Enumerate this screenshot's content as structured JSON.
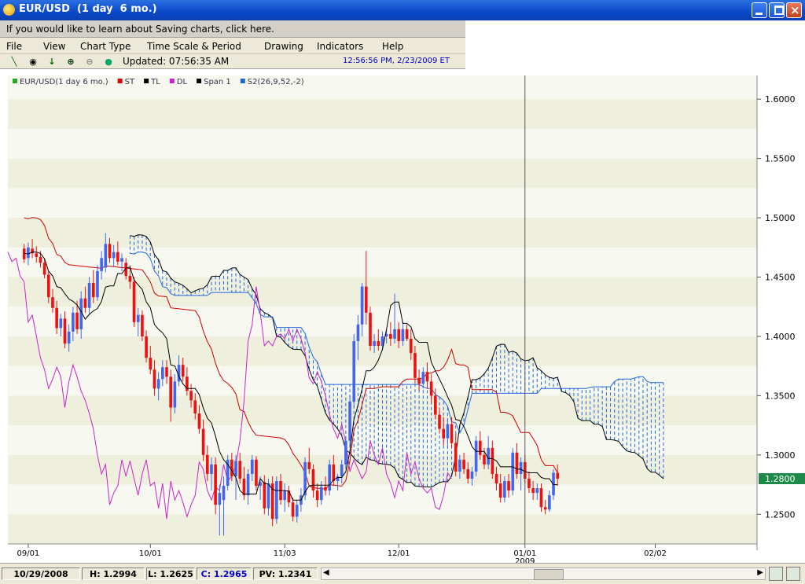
{
  "window": {
    "title": "EUR/USD  (1 day  6 mo.)"
  },
  "banner": {
    "text": "If you would like to learn about Saving charts, click here."
  },
  "menu": [
    "File",
    "View",
    "Chart Type",
    "Time Scale & Period",
    "Drawing",
    "Indicators",
    "Help"
  ],
  "toolbar": {
    "icons": [
      "line-tool-icon",
      "target-icon",
      "down-arrow-icon",
      "zoom-in-icon",
      "zoom-out-icon",
      "globe-icon"
    ],
    "updated": "Updated: 07:56:35 AM",
    "datetime": "12:56:56 PM, 2/23/2009 ET"
  },
  "legend": [
    {
      "label": "EUR/USD(1 day  6 mo.)",
      "color": "#22aa22"
    },
    {
      "label": "ST",
      "color": "#dd0000"
    },
    {
      "label": "TL",
      "color": "#000000"
    },
    {
      "label": "DL",
      "color": "#cc22cc"
    },
    {
      "label": "Span 1",
      "color": "#000000"
    },
    {
      "label": "S2(26,9,52,-2)",
      "color": "#2266dd"
    }
  ],
  "current_price": "1.2800",
  "status": {
    "date": "10/29/2008",
    "high": "H: 1.2994",
    "low": "L: 1.2625",
    "close": "C: 1.2965",
    "pv": "PV: 1.2341"
  },
  "chart_data": {
    "type": "candlestick",
    "y_ticks": [
      "1.6000",
      "1.5500",
      "1.5000",
      "1.4500",
      "1.4000",
      "1.3500",
      "1.3000",
      "1.2500"
    ],
    "ylim": [
      1.225,
      1.62
    ],
    "x_ticks": [
      {
        "label": "09/01",
        "day": 1
      },
      {
        "label": "10/01",
        "day": 31
      },
      {
        "label": "11/03",
        "day": 64
      },
      {
        "label": "12/01",
        "day": 92
      },
      {
        "label": "01/01",
        "sublabel": "2009",
        "day": 123
      },
      {
        "label": "02/02",
        "day": 155
      }
    ],
    "x_range": [
      -4,
      180
    ],
    "crosshair_day": 123,
    "colors": {
      "up": "#4466ee",
      "down": "#ee1111",
      "tl": "#000000",
      "st": "#cc0000",
      "dl": "#cc22cc",
      "cloud": "#2266dd"
    },
    "candles": [
      {
        "d": 0,
        "o": 1.474,
        "h": 1.478,
        "l": 1.462,
        "c": 1.465
      },
      {
        "d": 1,
        "o": 1.466,
        "h": 1.479,
        "l": 1.46,
        "c": 1.475
      },
      {
        "d": 2,
        "o": 1.474,
        "h": 1.482,
        "l": 1.466,
        "c": 1.47
      },
      {
        "d": 3,
        "o": 1.47,
        "h": 1.476,
        "l": 1.462,
        "c": 1.467
      },
      {
        "d": 4,
        "o": 1.467,
        "h": 1.472,
        "l": 1.458,
        "c": 1.462
      },
      {
        "d": 5,
        "o": 1.462,
        "h": 1.466,
        "l": 1.449,
        "c": 1.452
      },
      {
        "d": 6,
        "o": 1.452,
        "h": 1.455,
        "l": 1.428,
        "c": 1.433
      },
      {
        "d": 7,
        "o": 1.433,
        "h": 1.44,
        "l": 1.42,
        "c": 1.424
      },
      {
        "d": 8,
        "o": 1.424,
        "h": 1.43,
        "l": 1.402,
        "c": 1.407
      },
      {
        "d": 9,
        "o": 1.407,
        "h": 1.419,
        "l": 1.4,
        "c": 1.415
      },
      {
        "d": 10,
        "o": 1.415,
        "h": 1.421,
        "l": 1.39,
        "c": 1.394
      },
      {
        "d": 11,
        "o": 1.394,
        "h": 1.41,
        "l": 1.387,
        "c": 1.404
      },
      {
        "d": 12,
        "o": 1.404,
        "h": 1.425,
        "l": 1.396,
        "c": 1.42
      },
      {
        "d": 13,
        "o": 1.42,
        "h": 1.43,
        "l": 1.402,
        "c": 1.406
      },
      {
        "d": 14,
        "o": 1.406,
        "h": 1.438,
        "l": 1.398,
        "c": 1.432
      },
      {
        "d": 15,
        "o": 1.432,
        "h": 1.442,
        "l": 1.42,
        "c": 1.424
      },
      {
        "d": 16,
        "o": 1.424,
        "h": 1.45,
        "l": 1.419,
        "c": 1.445
      },
      {
        "d": 17,
        "o": 1.445,
        "h": 1.456,
        "l": 1.428,
        "c": 1.433
      },
      {
        "d": 18,
        "o": 1.433,
        "h": 1.46,
        "l": 1.43,
        "c": 1.455
      },
      {
        "d": 19,
        "o": 1.455,
        "h": 1.472,
        "l": 1.448,
        "c": 1.466
      },
      {
        "d": 20,
        "o": 1.458,
        "h": 1.487,
        "l": 1.454,
        "c": 1.478
      },
      {
        "d": 21,
        "o": 1.478,
        "h": 1.483,
        "l": 1.462,
        "c": 1.466
      },
      {
        "d": 22,
        "o": 1.466,
        "h": 1.477,
        "l": 1.459,
        "c": 1.471
      },
      {
        "d": 23,
        "o": 1.471,
        "h": 1.48,
        "l": 1.46,
        "c": 1.463
      },
      {
        "d": 24,
        "o": 1.463,
        "h": 1.47,
        "l": 1.455,
        "c": 1.466
      },
      {
        "d": 25,
        "o": 1.462,
        "h": 1.466,
        "l": 1.448,
        "c": 1.451
      },
      {
        "d": 26,
        "o": 1.451,
        "h": 1.46,
        "l": 1.44,
        "c": 1.446
      },
      {
        "d": 27,
        "o": 1.446,
        "h": 1.45,
        "l": 1.408,
        "c": 1.412
      },
      {
        "d": 28,
        "o": 1.412,
        "h": 1.424,
        "l": 1.4,
        "c": 1.418
      },
      {
        "d": 29,
        "o": 1.418,
        "h": 1.422,
        "l": 1.396,
        "c": 1.4
      },
      {
        "d": 30,
        "o": 1.4,
        "h": 1.405,
        "l": 1.378,
        "c": 1.382
      },
      {
        "d": 31,
        "o": 1.382,
        "h": 1.392,
        "l": 1.368,
        "c": 1.372
      },
      {
        "d": 32,
        "o": 1.372,
        "h": 1.38,
        "l": 1.35,
        "c": 1.356
      },
      {
        "d": 33,
        "o": 1.356,
        "h": 1.37,
        "l": 1.346,
        "c": 1.364
      },
      {
        "d": 34,
        "o": 1.364,
        "h": 1.38,
        "l": 1.358,
        "c": 1.374
      },
      {
        "d": 35,
        "o": 1.374,
        "h": 1.38,
        "l": 1.36,
        "c": 1.366
      },
      {
        "d": 36,
        "o": 1.366,
        "h": 1.372,
        "l": 1.328,
        "c": 1.34
      },
      {
        "d": 37,
        "o": 1.34,
        "h": 1.368,
        "l": 1.335,
        "c": 1.362
      },
      {
        "d": 38,
        "o": 1.362,
        "h": 1.384,
        "l": 1.358,
        "c": 1.376
      },
      {
        "d": 39,
        "o": 1.376,
        "h": 1.382,
        "l": 1.362,
        "c": 1.366
      },
      {
        "d": 40,
        "o": 1.366,
        "h": 1.374,
        "l": 1.35,
        "c": 1.354
      },
      {
        "d": 41,
        "o": 1.354,
        "h": 1.36,
        "l": 1.34,
        "c": 1.346
      },
      {
        "d": 42,
        "o": 1.346,
        "h": 1.352,
        "l": 1.33,
        "c": 1.335
      },
      {
        "d": 43,
        "o": 1.335,
        "h": 1.342,
        "l": 1.318,
        "c": 1.322
      },
      {
        "d": 44,
        "o": 1.322,
        "h": 1.33,
        "l": 1.295,
        "c": 1.3
      },
      {
        "d": 45,
        "o": 1.3,
        "h": 1.308,
        "l": 1.278,
        "c": 1.284
      },
      {
        "d": 46,
        "o": 1.284,
        "h": 1.298,
        "l": 1.27,
        "c": 1.292
      },
      {
        "d": 47,
        "o": 1.292,
        "h": 1.298,
        "l": 1.25,
        "c": 1.258
      },
      {
        "d": 48,
        "o": 1.258,
        "h": 1.275,
        "l": 1.232,
        "c": 1.268
      },
      {
        "d": 49,
        "o": 1.262,
        "h": 1.282,
        "l": 1.232,
        "c": 1.274
      },
      {
        "d": 50,
        "o": 1.274,
        "h": 1.3,
        "l": 1.27,
        "c": 1.296
      },
      {
        "d": 51,
        "o": 1.296,
        "h": 1.302,
        "l": 1.278,
        "c": 1.282
      },
      {
        "d": 52,
        "o": 1.282,
        "h": 1.3,
        "l": 1.262,
        "c": 1.295
      },
      {
        "d": 53,
        "o": 1.295,
        "h": 1.302,
        "l": 1.276,
        "c": 1.28
      },
      {
        "d": 54,
        "o": 1.28,
        "h": 1.29,
        "l": 1.262,
        "c": 1.266
      },
      {
        "d": 55,
        "o": 1.266,
        "h": 1.288,
        "l": 1.258,
        "c": 1.284
      },
      {
        "d": 56,
        "o": 1.284,
        "h": 1.3,
        "l": 1.278,
        "c": 1.296
      },
      {
        "d": 57,
        "o": 1.296,
        "h": 1.299,
        "l": 1.27,
        "c": 1.274
      },
      {
        "d": 58,
        "o": 1.274,
        "h": 1.282,
        "l": 1.262,
        "c": 1.277
      },
      {
        "d": 59,
        "o": 1.277,
        "h": 1.283,
        "l": 1.25,
        "c": 1.255
      },
      {
        "d": 60,
        "o": 1.255,
        "h": 1.28,
        "l": 1.249,
        "c": 1.276
      },
      {
        "d": 61,
        "o": 1.276,
        "h": 1.282,
        "l": 1.24,
        "c": 1.246
      },
      {
        "d": 62,
        "o": 1.246,
        "h": 1.282,
        "l": 1.242,
        "c": 1.278
      },
      {
        "d": 63,
        "o": 1.278,
        "h": 1.284,
        "l": 1.258,
        "c": 1.262
      },
      {
        "d": 64,
        "o": 1.262,
        "h": 1.276,
        "l": 1.252,
        "c": 1.27
      },
      {
        "d": 65,
        "o": 1.27,
        "h": 1.274,
        "l": 1.256,
        "c": 1.26
      },
      {
        "d": 66,
        "o": 1.26,
        "h": 1.264,
        "l": 1.244,
        "c": 1.248
      },
      {
        "d": 67,
        "o": 1.248,
        "h": 1.262,
        "l": 1.243,
        "c": 1.258
      },
      {
        "d": 68,
        "o": 1.258,
        "h": 1.272,
        "l": 1.252,
        "c": 1.266
      },
      {
        "d": 69,
        "o": 1.266,
        "h": 1.298,
        "l": 1.262,
        "c": 1.294
      },
      {
        "d": 70,
        "o": 1.294,
        "h": 1.306,
        "l": 1.284,
        "c": 1.288
      },
      {
        "d": 71,
        "o": 1.288,
        "h": 1.292,
        "l": 1.264,
        "c": 1.27
      },
      {
        "d": 72,
        "o": 1.27,
        "h": 1.276,
        "l": 1.256,
        "c": 1.262
      },
      {
        "d": 73,
        "o": 1.262,
        "h": 1.278,
        "l": 1.258,
        "c": 1.273
      },
      {
        "d": 74,
        "o": 1.273,
        "h": 1.282,
        "l": 1.266,
        "c": 1.27
      },
      {
        "d": 75,
        "o": 1.27,
        "h": 1.296,
        "l": 1.266,
        "c": 1.292
      },
      {
        "d": 76,
        "o": 1.292,
        "h": 1.3,
        "l": 1.274,
        "c": 1.278
      },
      {
        "d": 77,
        "o": 1.278,
        "h": 1.284,
        "l": 1.27,
        "c": 1.282
      },
      {
        "d": 78,
        "o": 1.282,
        "h": 1.296,
        "l": 1.276,
        "c": 1.292
      },
      {
        "d": 79,
        "o": 1.292,
        "h": 1.316,
        "l": 1.288,
        "c": 1.312
      },
      {
        "d": 80,
        "o": 1.312,
        "h": 1.35,
        "l": 1.306,
        "c": 1.345
      },
      {
        "d": 81,
        "o": 1.345,
        "h": 1.402,
        "l": 1.34,
        "c": 1.396
      },
      {
        "d": 82,
        "o": 1.396,
        "h": 1.418,
        "l": 1.38,
        "c": 1.41
      },
      {
        "d": 83,
        "o": 1.41,
        "h": 1.445,
        "l": 1.4,
        "c": 1.442
      },
      {
        "d": 84,
        "o": 1.442,
        "h": 1.472,
        "l": 1.41,
        "c": 1.42
      },
      {
        "d": 85,
        "o": 1.42,
        "h": 1.425,
        "l": 1.388,
        "c": 1.392
      },
      {
        "d": 86,
        "o": 1.392,
        "h": 1.402,
        "l": 1.386,
        "c": 1.396
      },
      {
        "d": 87,
        "o": 1.396,
        "h": 1.406,
        "l": 1.388,
        "c": 1.392
      },
      {
        "d": 88,
        "o": 1.392,
        "h": 1.404,
        "l": 1.388,
        "c": 1.4
      },
      {
        "d": 89,
        "o": 1.4,
        "h": 1.406,
        "l": 1.394,
        "c": 1.402
      },
      {
        "d": 90,
        "o": 1.402,
        "h": 1.412,
        "l": 1.392,
        "c": 1.398
      },
      {
        "d": 91,
        "o": 1.398,
        "h": 1.436,
        "l": 1.394,
        "c": 1.406
      },
      {
        "d": 92,
        "o": 1.406,
        "h": 1.412,
        "l": 1.39,
        "c": 1.396
      },
      {
        "d": 93,
        "o": 1.396,
        "h": 1.412,
        "l": 1.392,
        "c": 1.406
      },
      {
        "d": 94,
        "o": 1.406,
        "h": 1.41,
        "l": 1.396,
        "c": 1.398
      },
      {
        "d": 95,
        "o": 1.398,
        "h": 1.406,
        "l": 1.38,
        "c": 1.386
      },
      {
        "d": 96,
        "o": 1.386,
        "h": 1.392,
        "l": 1.36,
        "c": 1.365
      },
      {
        "d": 97,
        "o": 1.365,
        "h": 1.372,
        "l": 1.354,
        "c": 1.36
      },
      {
        "d": 98,
        "o": 1.36,
        "h": 1.374,
        "l": 1.356,
        "c": 1.37
      },
      {
        "d": 99,
        "o": 1.37,
        "h": 1.378,
        "l": 1.356,
        "c": 1.362
      },
      {
        "d": 100,
        "o": 1.362,
        "h": 1.368,
        "l": 1.344,
        "c": 1.35
      },
      {
        "d": 101,
        "o": 1.35,
        "h": 1.356,
        "l": 1.33,
        "c": 1.334
      },
      {
        "d": 102,
        "o": 1.334,
        "h": 1.34,
        "l": 1.318,
        "c": 1.322
      },
      {
        "d": 103,
        "o": 1.322,
        "h": 1.332,
        "l": 1.308,
        "c": 1.314
      },
      {
        "d": 104,
        "o": 1.314,
        "h": 1.33,
        "l": 1.306,
        "c": 1.326
      },
      {
        "d": 105,
        "o": 1.326,
        "h": 1.332,
        "l": 1.306,
        "c": 1.31
      },
      {
        "d": 106,
        "o": 1.31,
        "h": 1.318,
        "l": 1.282,
        "c": 1.286
      },
      {
        "d": 107,
        "o": 1.286,
        "h": 1.3,
        "l": 1.28,
        "c": 1.296
      },
      {
        "d": 108,
        "o": 1.296,
        "h": 1.302,
        "l": 1.284,
        "c": 1.288
      },
      {
        "d": 109,
        "o": 1.288,
        "h": 1.294,
        "l": 1.276,
        "c": 1.28
      },
      {
        "d": 110,
        "o": 1.28,
        "h": 1.29,
        "l": 1.274,
        "c": 1.286
      },
      {
        "d": 111,
        "o": 1.286,
        "h": 1.316,
        "l": 1.282,
        "c": 1.312
      },
      {
        "d": 112,
        "o": 1.312,
        "h": 1.32,
        "l": 1.296,
        "c": 1.3
      },
      {
        "d": 113,
        "o": 1.3,
        "h": 1.306,
        "l": 1.288,
        "c": 1.292
      },
      {
        "d": 114,
        "o": 1.292,
        "h": 1.316,
        "l": 1.288,
        "c": 1.306
      },
      {
        "d": 115,
        "o": 1.306,
        "h": 1.312,
        "l": 1.28,
        "c": 1.284
      },
      {
        "d": 116,
        "o": 1.284,
        "h": 1.29,
        "l": 1.27,
        "c": 1.276
      },
      {
        "d": 117,
        "o": 1.276,
        "h": 1.284,
        "l": 1.26,
        "c": 1.264
      },
      {
        "d": 118,
        "o": 1.264,
        "h": 1.282,
        "l": 1.26,
        "c": 1.278
      },
      {
        "d": 119,
        "o": 1.278,
        "h": 1.284,
        "l": 1.264,
        "c": 1.27
      },
      {
        "d": 120,
        "o": 1.27,
        "h": 1.306,
        "l": 1.266,
        "c": 1.302
      },
      {
        "d": 121,
        "o": 1.302,
        "h": 1.31,
        "l": 1.28,
        "c": 1.284
      },
      {
        "d": 122,
        "o": 1.284,
        "h": 1.298,
        "l": 1.27,
        "c": 1.294
      },
      {
        "d": 123,
        "o": 1.294,
        "h": 1.3,
        "l": 1.276,
        "c": 1.28
      },
      {
        "d": 124,
        "o": 1.28,
        "h": 1.286,
        "l": 1.268,
        "c": 1.272
      },
      {
        "d": 125,
        "o": 1.272,
        "h": 1.278,
        "l": 1.262,
        "c": 1.268
      },
      {
        "d": 126,
        "o": 1.268,
        "h": 1.276,
        "l": 1.262,
        "c": 1.272
      },
      {
        "d": 127,
        "o": 1.272,
        "h": 1.276,
        "l": 1.252,
        "c": 1.256
      },
      {
        "d": 128,
        "o": 1.256,
        "h": 1.262,
        "l": 1.25,
        "c": 1.254
      },
      {
        "d": 129,
        "o": 1.254,
        "h": 1.27,
        "l": 1.252,
        "c": 1.266
      },
      {
        "d": 130,
        "o": 1.266,
        "h": 1.288,
        "l": 1.262,
        "c": 1.285
      },
      {
        "d": 131,
        "o": 1.285,
        "h": 1.292,
        "l": 1.274,
        "c": 1.28
      }
    ],
    "tl": [],
    "st": [],
    "dl": [],
    "span_a": [],
    "span_b": []
  }
}
